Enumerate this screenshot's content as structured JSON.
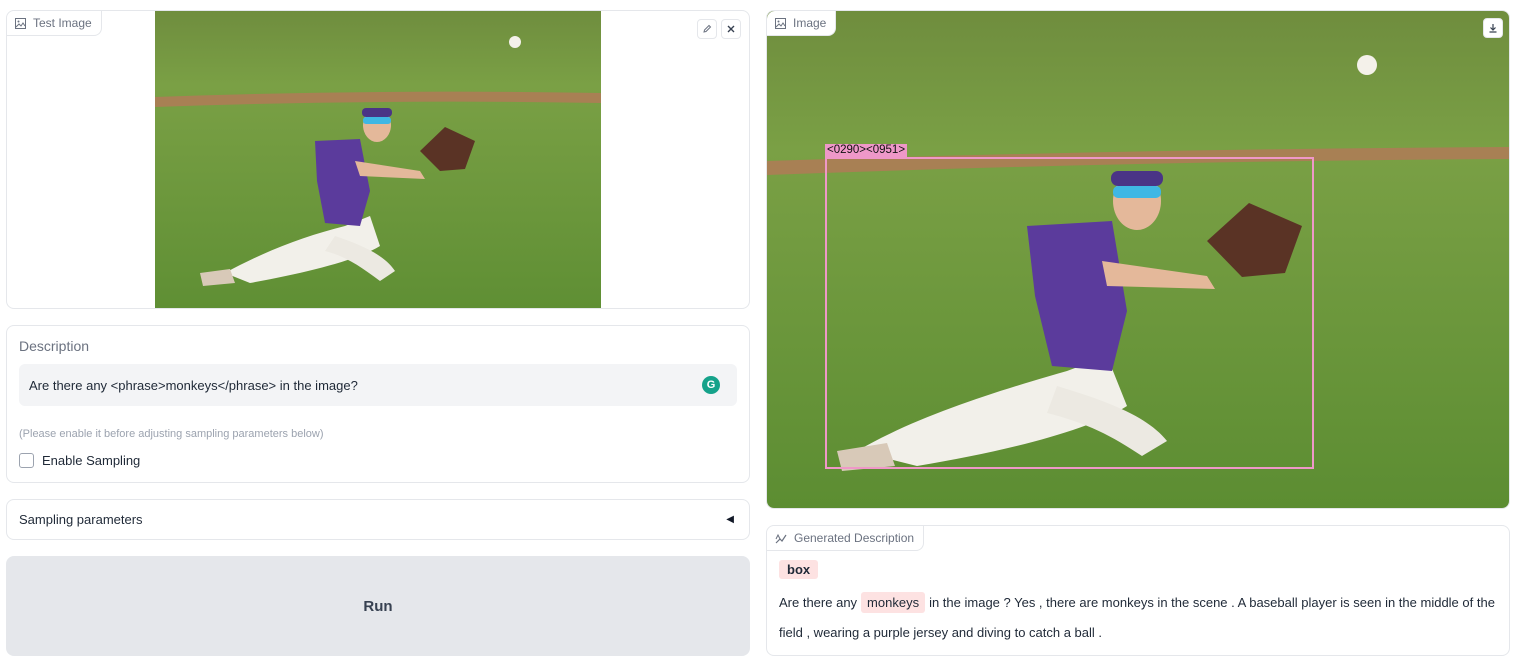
{
  "input_image": {
    "label": "Test Image",
    "icons": [
      "image-icon",
      "edit-icon",
      "close-icon"
    ]
  },
  "description": {
    "label": "Description",
    "value": "Are there any <phrase>monkeys</phrase> in the image?",
    "grammarly_glyph": "G",
    "hint": "(Please enable it before adjusting sampling parameters below)",
    "enable_sampling_label": "Enable Sampling",
    "enable_sampling_checked": false
  },
  "sampling": {
    "label": "Sampling parameters",
    "toggle_glyph": "◀",
    "expanded": false
  },
  "run": {
    "label": "Run"
  },
  "output_image": {
    "label": "Image",
    "box_label": "<0290><0951>",
    "box_color": "#ef98c8",
    "icons": [
      "image-icon",
      "download-icon"
    ]
  },
  "generated": {
    "label": "Generated Description",
    "legend": "box",
    "text_before": "Are there any",
    "highlight": "monkeys",
    "text_after": "in the image ? Yes , there are monkeys in the scene . A baseball player is seen in the middle of the field , wearing a purple jersey and diving to catch a ball .",
    "highlight_color": "#fde2e2"
  }
}
